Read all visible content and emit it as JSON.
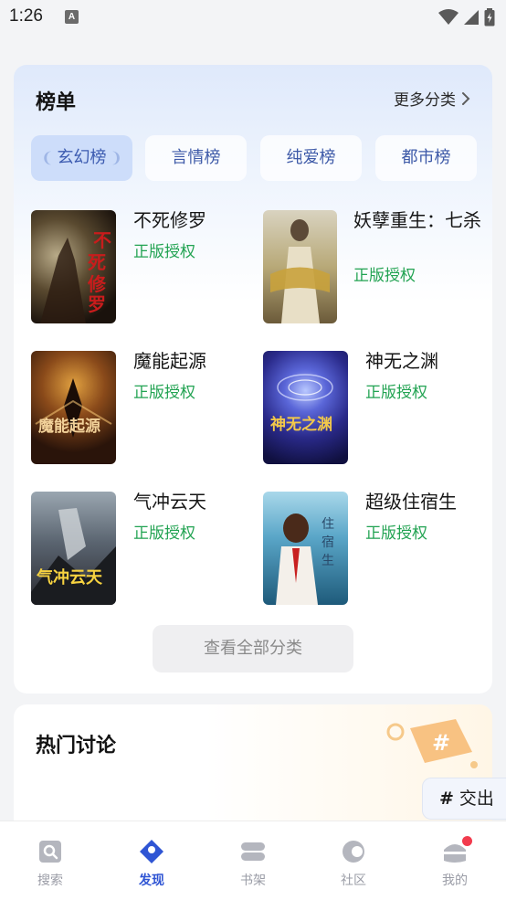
{
  "status_bar": {
    "time": "1:26",
    "notification_icon": "A"
  },
  "ranking": {
    "title": "榜单",
    "more_label": "更多分类",
    "tabs": [
      {
        "label": "玄幻榜",
        "active": true
      },
      {
        "label": "言情榜",
        "active": false
      },
      {
        "label": "纯爱榜",
        "active": false
      },
      {
        "label": "都市榜",
        "active": false
      }
    ],
    "books": [
      {
        "title": "不死修罗",
        "tag": "正版授权"
      },
      {
        "title": "妖孽重生：七杀",
        "tag": "正版授权"
      },
      {
        "title": "魔能起源",
        "tag": "正版授权"
      },
      {
        "title": "神无之渊",
        "tag": "正版授权"
      },
      {
        "title": "气冲云天",
        "tag": "正版授权"
      },
      {
        "title": "超级住宿生",
        "tag": "正版授权"
      }
    ],
    "view_all_label": "查看全部分类"
  },
  "hot": {
    "title": "热门讨论",
    "chip_hash": "#",
    "chip_label": "交出"
  },
  "nav": {
    "items": [
      {
        "label": "搜索",
        "icon": "search-icon"
      },
      {
        "label": "发现",
        "icon": "discover-icon"
      },
      {
        "label": "书架",
        "icon": "bookshelf-icon"
      },
      {
        "label": "社区",
        "icon": "community-icon"
      },
      {
        "label": "我的",
        "icon": "profile-icon"
      }
    ],
    "active_index": 1
  },
  "colors": {
    "accent": "#2f55d4",
    "tag_green": "#22a352",
    "badge_red": "#f23b4d"
  }
}
